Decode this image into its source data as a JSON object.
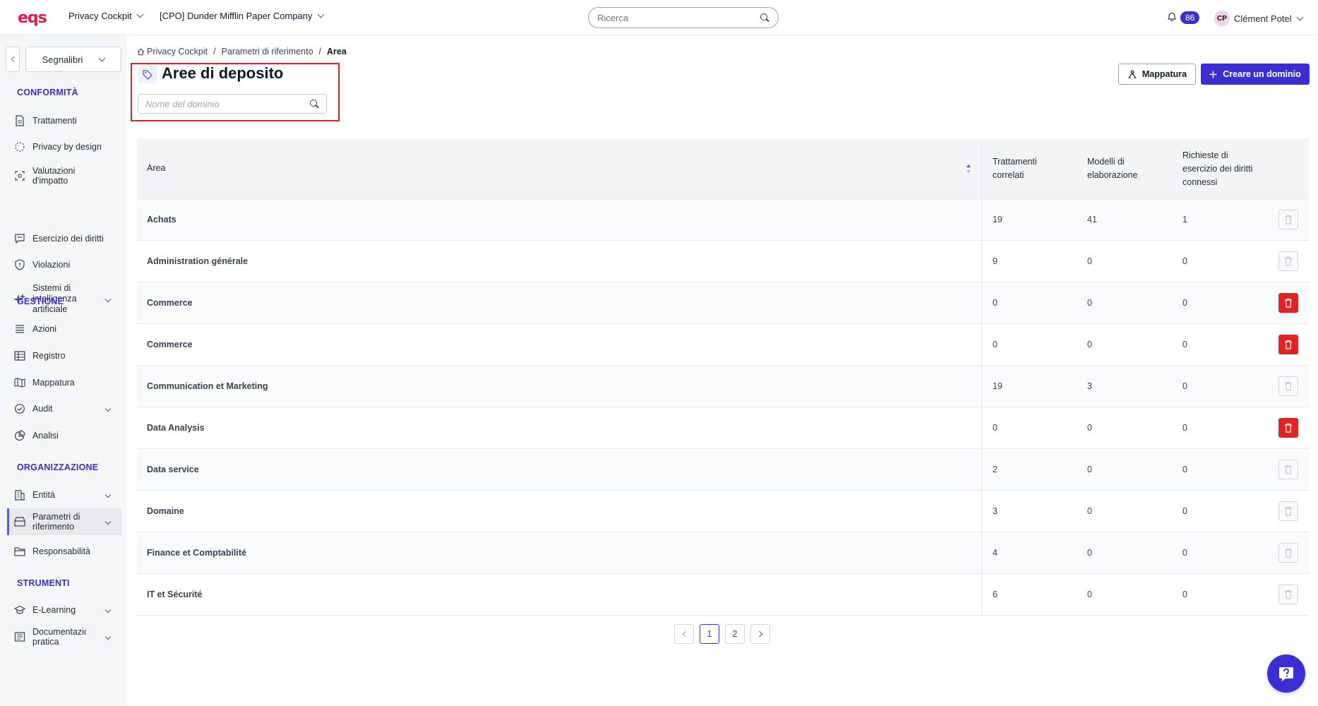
{
  "header": {
    "logo": "eqs",
    "app_switcher": "Privacy Cockpit",
    "company_switcher": "[CPO] Dunder Mifflin Paper Company",
    "search_placeholder": "Ricerca",
    "notifications_count": "86",
    "user_initials": "CP",
    "user_name": "Clément Potel"
  },
  "sidebar": {
    "bookmarks_label": "Segnalibri",
    "sections": {
      "conformita": "CONFORMITÀ",
      "gestione": "GESTIONE",
      "organizzazione": "ORGANIZZAZIONE",
      "strumenti": "STRUMENTI"
    },
    "items": {
      "trattamenti": "Trattamenti",
      "privacy_by_design": "Privacy by design",
      "valutazioni": "Valutazioni d'impatto",
      "esercizio": "Esercizio dei diritti",
      "violazioni": "Violazioni",
      "sistemi_ia": "Sistemi di intelligenza artificiale",
      "azioni": "Azioni",
      "registro": "Registro",
      "mappatura": "Mappatura",
      "audit": "Audit",
      "analisi": "Analisi",
      "entita": "Entità",
      "parametri": "Parametri di riferimento",
      "responsabilita": "Responsabilità",
      "elearning": "E-Learning",
      "documentazione": "Documentazio... pratica"
    }
  },
  "breadcrumb": [
    "Privacy Cockpit",
    "Parametri di riferimento",
    "Area"
  ],
  "page": {
    "title": "Aree di deposito",
    "search_placeholder": "Nome del dominio",
    "mapping_button": "Mappatura",
    "create_button": "Creare un dominio"
  },
  "table": {
    "headers": {
      "area": "Area",
      "trattamenti": "Trattamenti correlati",
      "modelli": "Modelli di elaborazione",
      "richieste": "Richieste di esercizio dei diritti connessi"
    },
    "rows": [
      {
        "name": "Achats",
        "trattamenti": "19",
        "modelli": "41",
        "richieste": "1",
        "deletable": false
      },
      {
        "name": "Administration générale",
        "trattamenti": "9",
        "modelli": "0",
        "richieste": "0",
        "deletable": false
      },
      {
        "name": "Commerce",
        "trattamenti": "0",
        "modelli": "0",
        "richieste": "0",
        "deletable": true
      },
      {
        "name": "Commerce",
        "trattamenti": "0",
        "modelli": "0",
        "richieste": "0",
        "deletable": true
      },
      {
        "name": "Communication et Marketing",
        "trattamenti": "19",
        "modelli": "3",
        "richieste": "0",
        "deletable": false
      },
      {
        "name": "Data Analysis",
        "trattamenti": "0",
        "modelli": "0",
        "richieste": "0",
        "deletable": true
      },
      {
        "name": "Data service",
        "trattamenti": "2",
        "modelli": "0",
        "richieste": "0",
        "deletable": false
      },
      {
        "name": "Domaine",
        "trattamenti": "3",
        "modelli": "0",
        "richieste": "0",
        "deletable": false
      },
      {
        "name": "Finance et Comptabilité",
        "trattamenti": "4",
        "modelli": "0",
        "richieste": "0",
        "deletable": false
      },
      {
        "name": "IT et Sécurité",
        "trattamenti": "6",
        "modelli": "0",
        "richieste": "0",
        "deletable": false
      }
    ]
  },
  "pagination": {
    "pages": [
      "1",
      "2"
    ],
    "current": "1"
  },
  "colors": {
    "accent": "#3b2fd4",
    "danger": "#e02424",
    "logo": "#e11d48"
  }
}
